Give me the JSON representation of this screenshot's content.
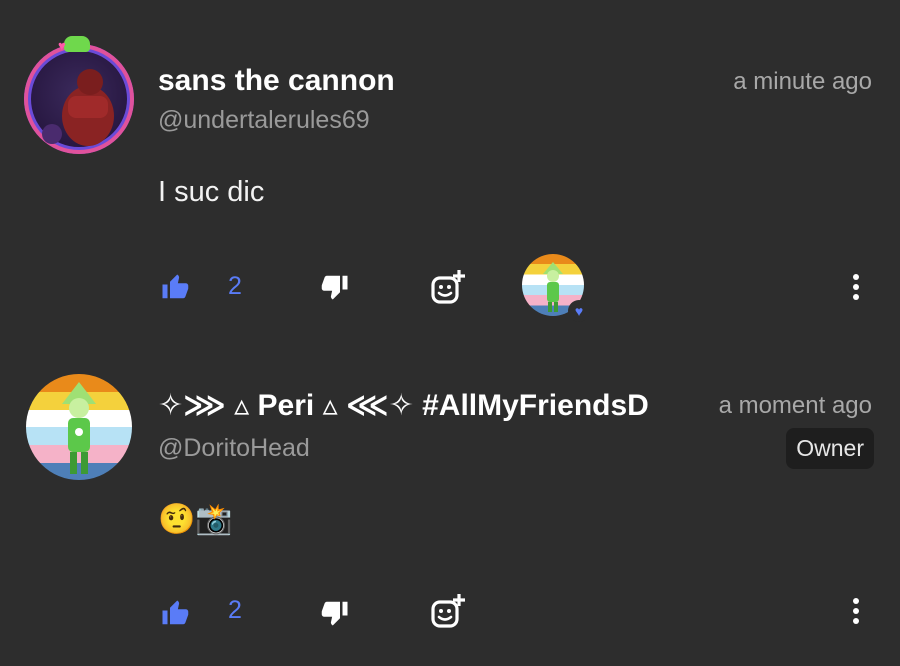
{
  "comments": [
    {
      "display_name": "sans the cannon",
      "handle": "@undertalerules69",
      "time": "a minute ago",
      "text": "I suc dic",
      "like_count": "2",
      "reacted_by_owner": true
    },
    {
      "display_name": "✧⋙ ▵ Peri ▵ ⋘✧ #AllMyFriendsD",
      "handle": "@DoritoHead",
      "time": "a moment ago",
      "badge": "Owner",
      "text": "🤨📸",
      "like_count": "2"
    }
  ],
  "colors": {
    "background": "#2d2d2d",
    "accent_blue": "#5a7cf7",
    "muted_text": "#9a9a9a"
  },
  "icons": {
    "like": "thumbs-up-icon",
    "dislike": "thumbs-down-icon",
    "react": "add-reaction-icon",
    "more": "more-vertical-icon"
  }
}
